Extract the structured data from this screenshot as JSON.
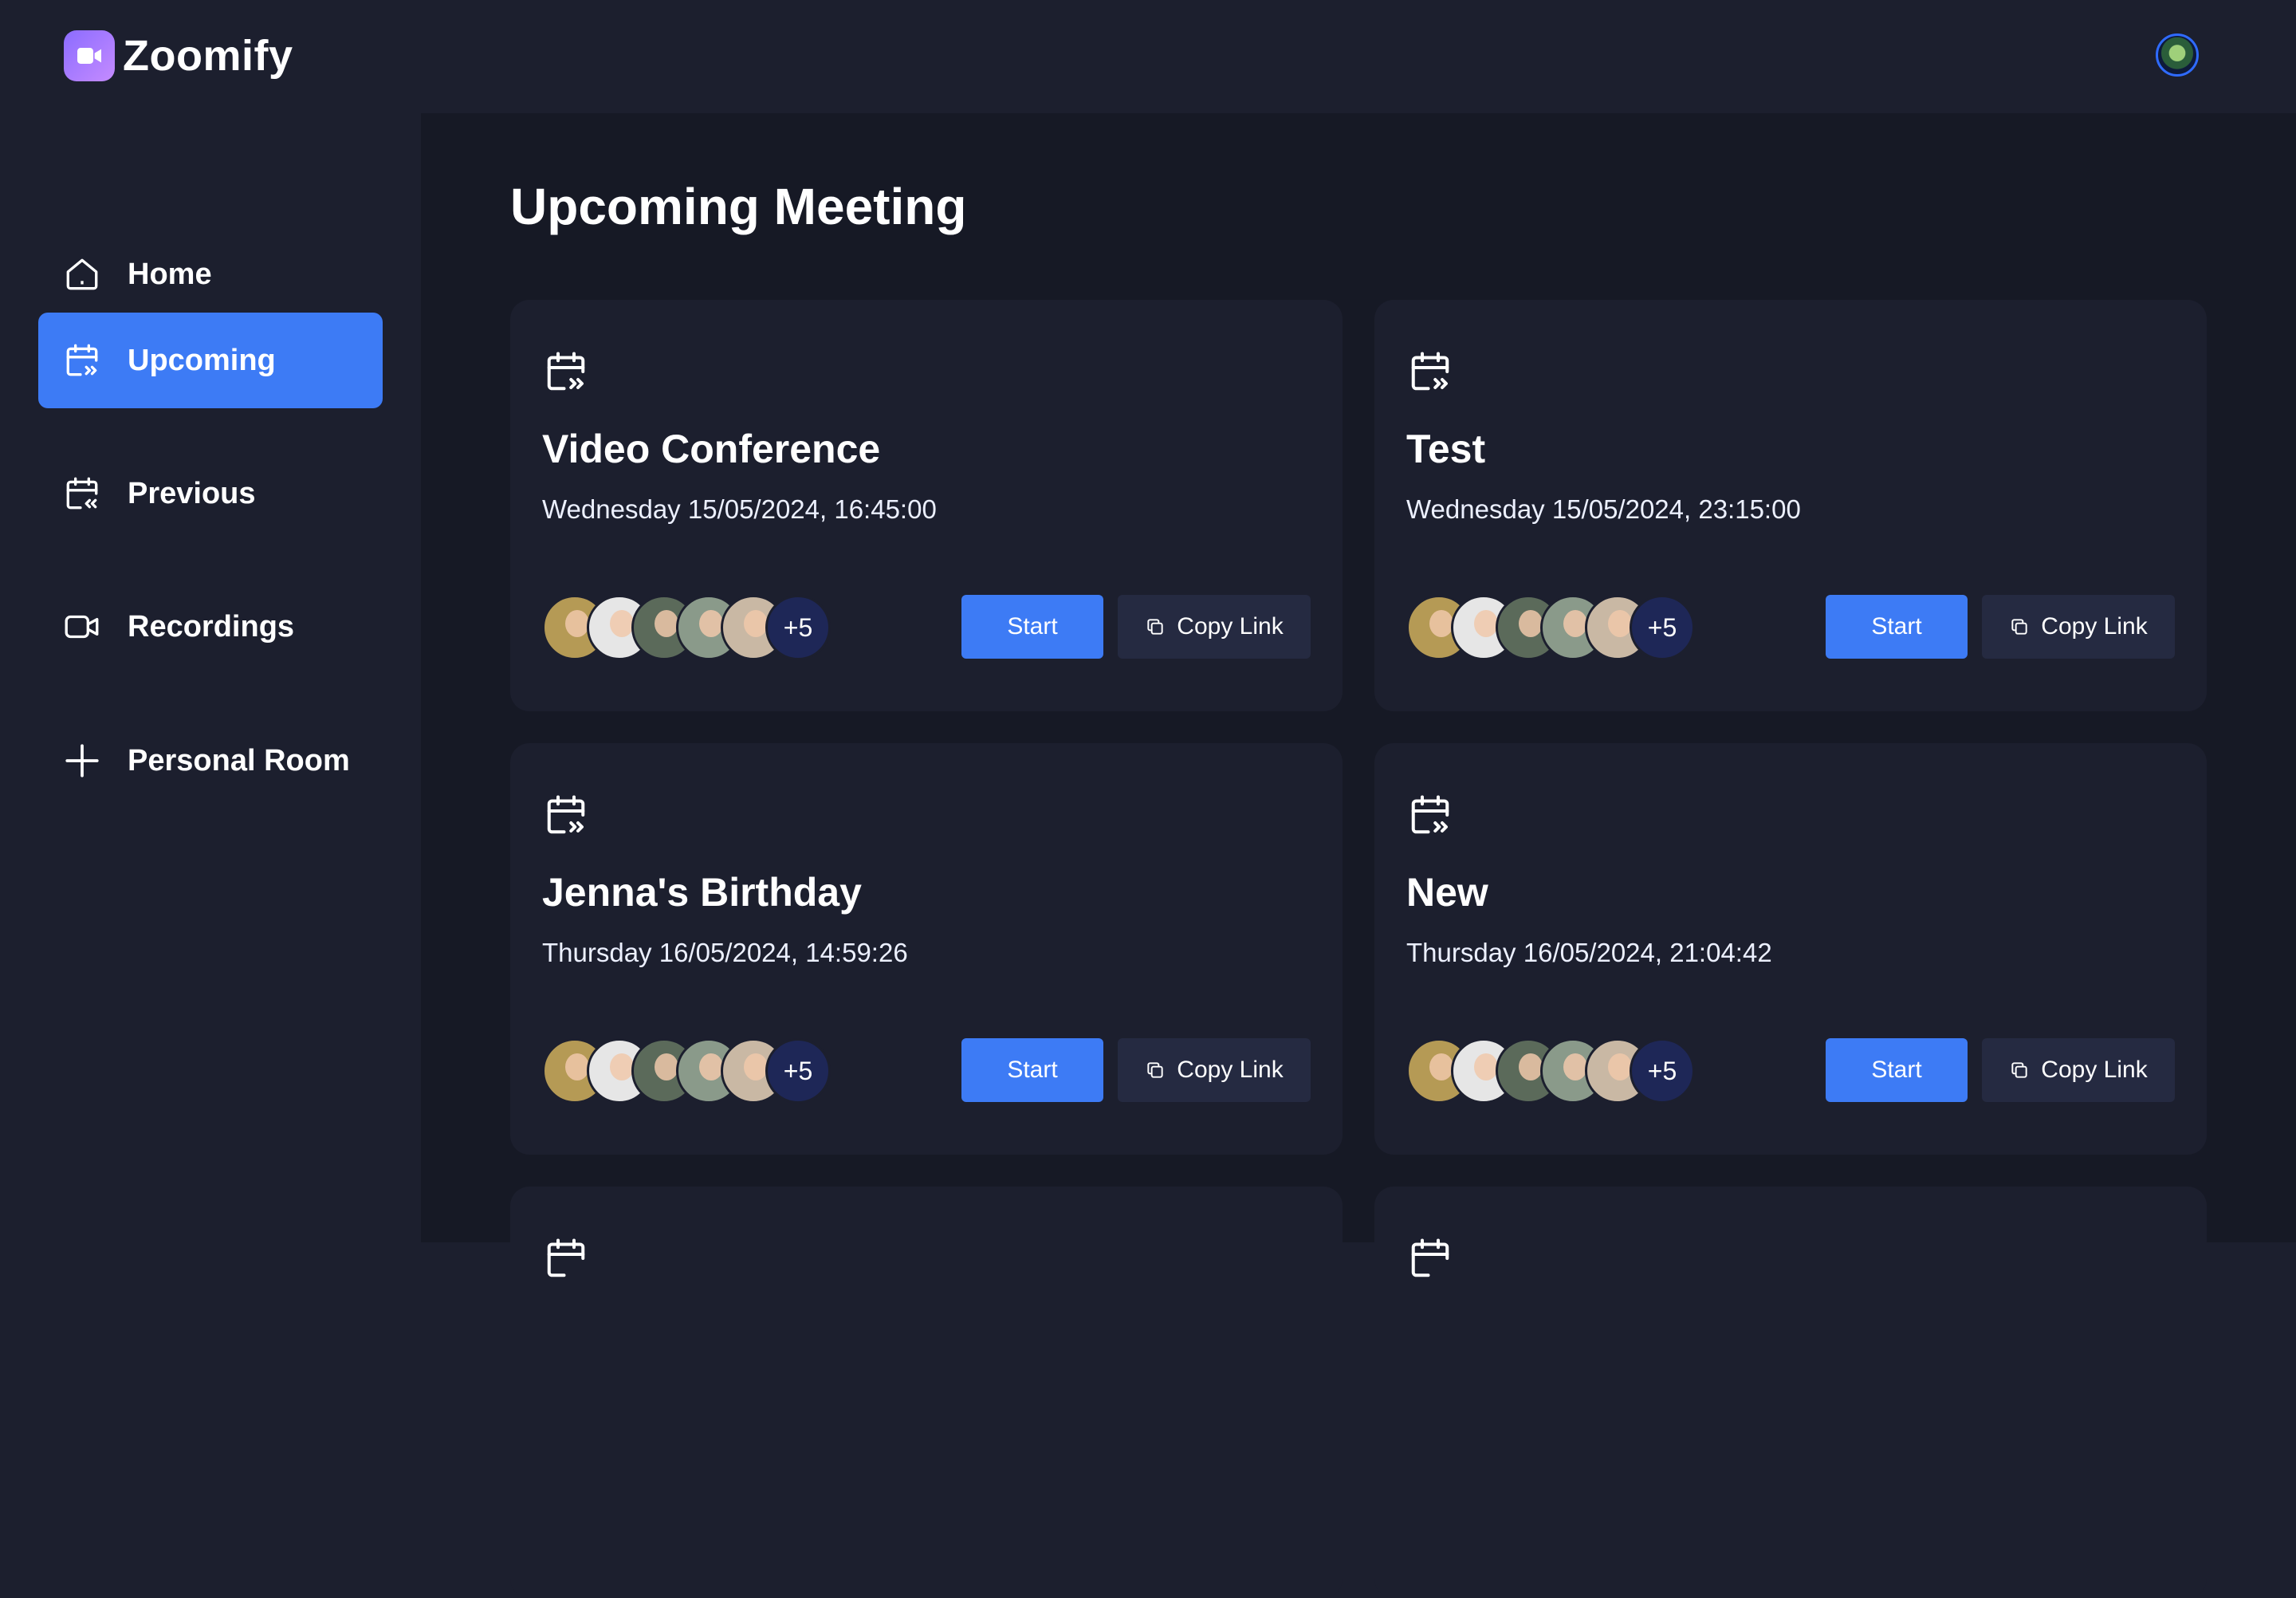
{
  "app": {
    "name": "Zoomify"
  },
  "nav": {
    "items": [
      {
        "label": "Home",
        "icon": "home-icon",
        "active": false
      },
      {
        "label": "Upcoming",
        "icon": "calendar-upcoming-icon",
        "active": true
      },
      {
        "label": "Previous",
        "icon": "calendar-previous-icon",
        "active": false
      },
      {
        "label": "Recordings",
        "icon": "video-camera-icon",
        "active": false
      },
      {
        "label": "Personal Room",
        "icon": "plus-icon",
        "active": false
      }
    ]
  },
  "main": {
    "title": "Upcoming Meeting",
    "meetings": [
      {
        "title": "Video Conference",
        "date": "Wednesday 15/05/2024, 16:45:00",
        "more_attendees": "+5",
        "start_label": "Start",
        "copy_label": "Copy Link"
      },
      {
        "title": "Test",
        "date": "Wednesday 15/05/2024, 23:15:00",
        "more_attendees": "+5",
        "start_label": "Start",
        "copy_label": "Copy Link"
      },
      {
        "title": "Jenna's Birthday",
        "date": "Thursday 16/05/2024, 14:59:26",
        "more_attendees": "+5",
        "start_label": "Start",
        "copy_label": "Copy Link"
      },
      {
        "title": "New",
        "date": "Thursday 16/05/2024, 21:04:42",
        "more_attendees": "+5",
        "start_label": "Start",
        "copy_label": "Copy Link"
      }
    ]
  },
  "colors": {
    "accent": "#3d7bf5",
    "sidebar_bg": "#1c1f2e",
    "main_bg": "#161925",
    "card_bg": "#1c1f2e",
    "copy_button_bg": "#252a41"
  }
}
